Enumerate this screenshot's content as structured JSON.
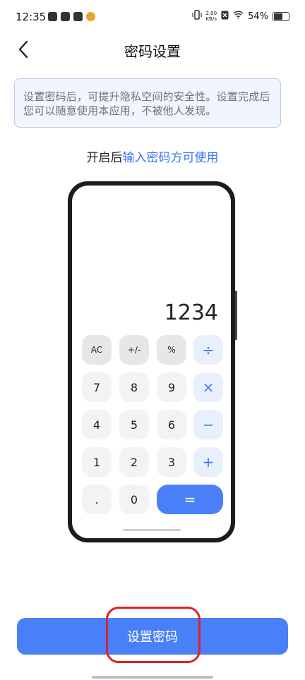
{
  "status": {
    "time": "12:35",
    "net_speed_value": "2.00",
    "net_speed_unit": "KB/s",
    "battery": "54%",
    "battery_level": 0.54
  },
  "header": {
    "title": "密码设置"
  },
  "notice": {
    "text": "设置密码后，可提升隐私空间的安全性。设置完成后您可以随意使用本应用，不被他人发现。"
  },
  "hint": {
    "prefix": "开启后",
    "accent": "输入密码方可使用"
  },
  "calculator": {
    "display": "1234",
    "keys": {
      "ac": "AC",
      "sign": "+/-",
      "percent": "%",
      "divide": "÷",
      "k7": "7",
      "k8": "8",
      "k9": "9",
      "multiply": "×",
      "k4": "4",
      "k5": "5",
      "k6": "6",
      "minus": "−",
      "k1": "1",
      "k2": "2",
      "k3": "3",
      "plus": "+",
      "dot": ".",
      "k0": "0",
      "equals": "="
    }
  },
  "primary_button": {
    "label": "设置密码"
  },
  "colors": {
    "accent": "#3975f5",
    "button": "#4a80f7",
    "highlight": "#e0202a"
  }
}
